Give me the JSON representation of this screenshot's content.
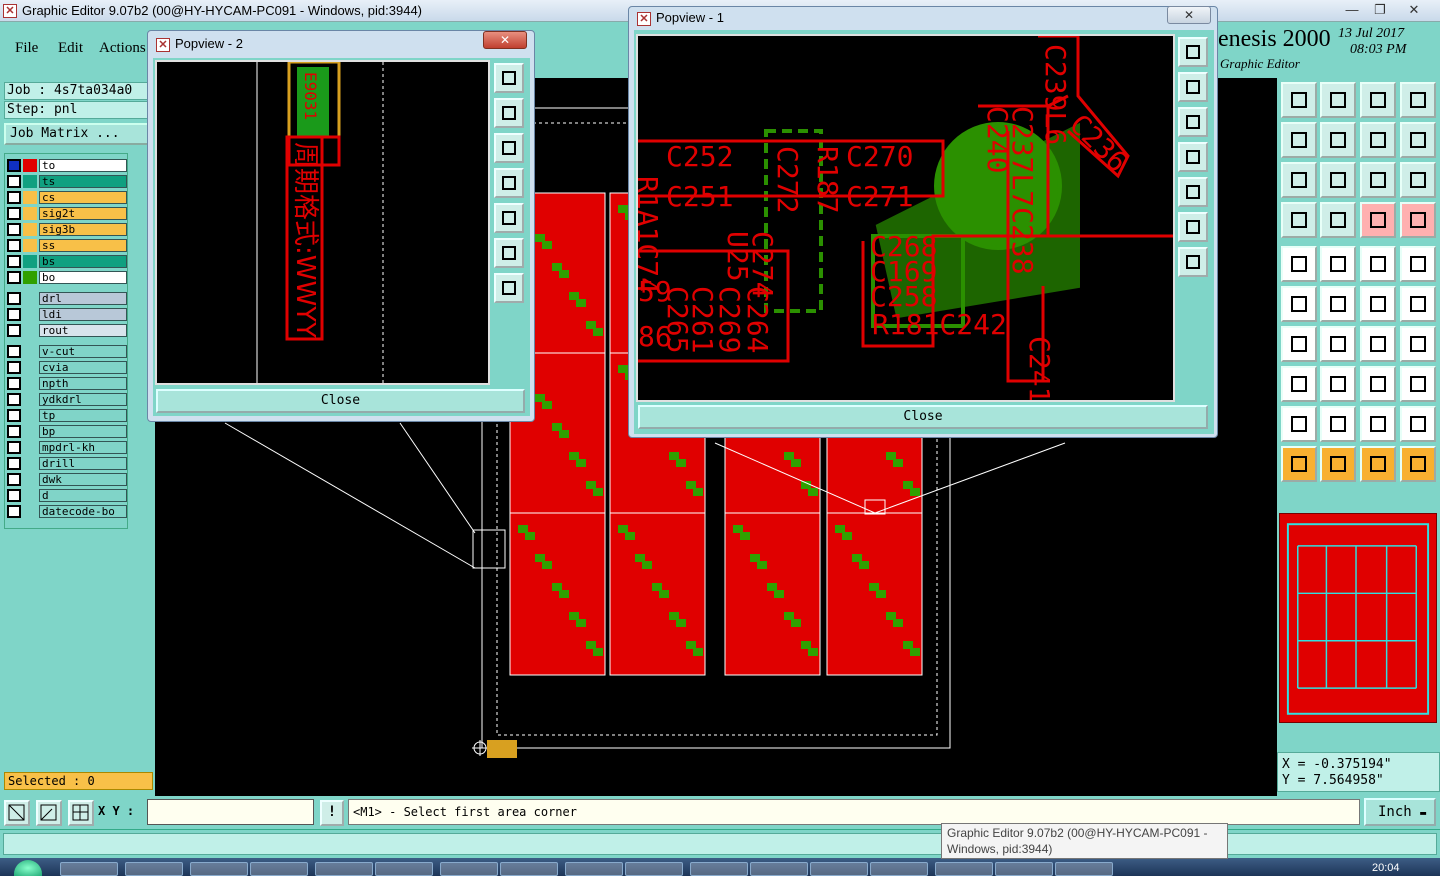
{
  "window": {
    "title": "Graphic Editor 9.07b2 (00@HY-HYCAM-PC091 - Windows, pid:3944)"
  },
  "menu": {
    "file": "File",
    "edit": "Edit",
    "actions": "Actions"
  },
  "brand": {
    "title": "enesis 2000",
    "subtitle": "Graphic Editor",
    "date": "13 Jul 2017",
    "time": "08:03 PM"
  },
  "job": {
    "job_label": "Job : 4s7ta034a0",
    "step_label": "Step: pnl",
    "matrix_button": "Job Matrix ..."
  },
  "layers": [
    {
      "name": "to",
      "color": "#e00000",
      "bg": "#ffffff"
    },
    {
      "name": "ts",
      "color": "#10a080",
      "bg": "#10a080"
    },
    {
      "name": "cs",
      "color": "#f8c048",
      "bg": "#f8c048"
    },
    {
      "name": "sig2t",
      "color": "#f8c048",
      "bg": "#f8c048"
    },
    {
      "name": "sig3b",
      "color": "#f8c048",
      "bg": "#f8c048"
    },
    {
      "name": "ss",
      "color": "#f8c048",
      "bg": "#f8c048"
    },
    {
      "name": "bs",
      "color": "#10a080",
      "bg": "#10a080"
    },
    {
      "name": "bo",
      "color": "#30a000",
      "bg": "#ffffff"
    },
    {
      "name": "drl",
      "color": "",
      "bg": "#b8c8d8"
    },
    {
      "name": "ldi",
      "color": "",
      "bg": "#b8c8d8"
    },
    {
      "name": "rout",
      "color": "",
      "bg": "#d8e4ec"
    },
    {
      "name": "v-cut",
      "color": "",
      "bg": "#80d4c8"
    },
    {
      "name": "cvia",
      "color": "",
      "bg": "#80d4c8"
    },
    {
      "name": "npth",
      "color": "",
      "bg": "#80d4c8"
    },
    {
      "name": "ydkdrl",
      "color": "",
      "bg": "#80d4c8"
    },
    {
      "name": "tp",
      "color": "",
      "bg": "#80d4c8"
    },
    {
      "name": "bp",
      "color": "",
      "bg": "#80d4c8"
    },
    {
      "name": "mpdrl-kh",
      "color": "",
      "bg": "#80d4c8"
    },
    {
      "name": "drill",
      "color": "",
      "bg": "#80d4c8"
    },
    {
      "name": "dwk",
      "color": "",
      "bg": "#80d4c8"
    },
    {
      "name": "d",
      "color": "",
      "bg": "#80d4c8"
    },
    {
      "name": "datecode-bo",
      "color": "",
      "bg": "#80d4c8"
    }
  ],
  "selected": "Selected : 0",
  "command": {
    "xy_label": "X Y :",
    "xy_value": "",
    "message": "<M1> - Select first area corner",
    "units": "Inch"
  },
  "coords": {
    "x": "X = -0.375194\"",
    "y": "Y = 7.564958\""
  },
  "popup1": {
    "title": "Popview - 1",
    "close": "Close",
    "labels": [
      "C239L6",
      "C236",
      "C240",
      "C237L7C238",
      "C252",
      "C270",
      "R187",
      "C251",
      "C271",
      "C272",
      "U25",
      "C274",
      "C268",
      "C169",
      "C258",
      "R181C242",
      "C241",
      "R1A1C74",
      "59",
      "86",
      "C265",
      "C261",
      "C269",
      "C264"
    ]
  },
  "popup2": {
    "title": "Popview - 2",
    "close": "Close",
    "vertical_text": "周期格式:WWYY",
    "box_text": "E9031"
  },
  "tooltip": {
    "line1": "Graphic Editor 9.07b2 (00@HY-HYCAM-PC091 -",
    "line2": "Windows, pid:3944)"
  },
  "taskbar": {
    "clock": "20:04"
  },
  "colors": {
    "teal": "#7fd5c8",
    "copper": "#e00000",
    "silk": "#30a000"
  }
}
